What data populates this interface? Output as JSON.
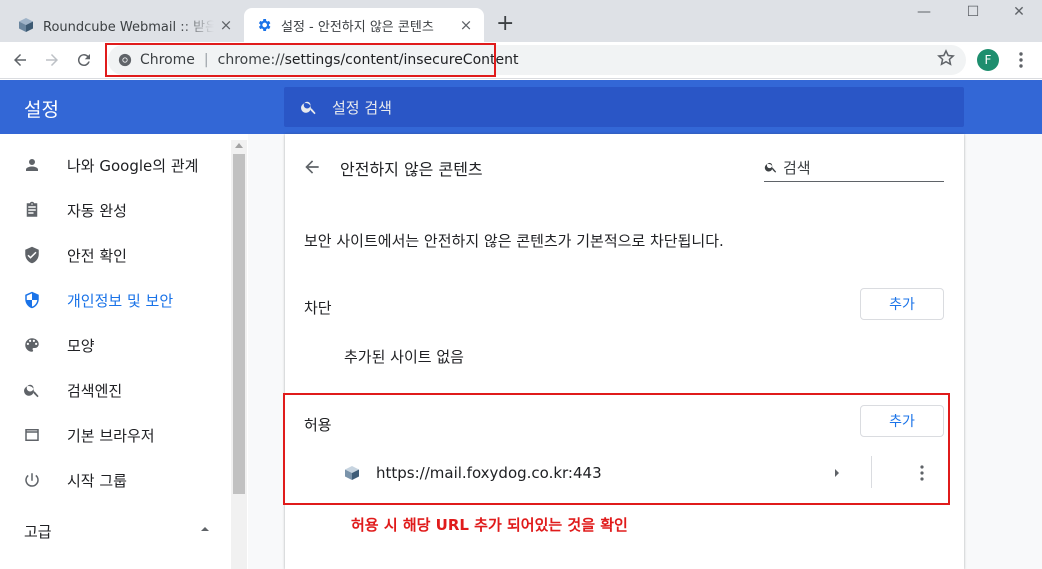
{
  "tabs": [
    {
      "title": "Roundcube Webmail :: 받은 편지함",
      "close": "×"
    },
    {
      "title": "설정 - 안전하지 않은 콘텐츠",
      "close": "×"
    }
  ],
  "newtab": "+",
  "window_controls": {
    "minimize": "—",
    "maximize": "☐",
    "close": "✕"
  },
  "toolbar": {
    "scheme_label": "Chrome",
    "separator": "|",
    "url_prefix": "chrome://",
    "url_path": "settings/content/insecureContent",
    "profile_initial": "F"
  },
  "settings": {
    "title": "설정",
    "search_placeholder": "설정 검색"
  },
  "sidebar": {
    "items": [
      {
        "label": "나와 Google의 관계",
        "icon": "person-icon"
      },
      {
        "label": "자동 완성",
        "icon": "clipboard-icon"
      },
      {
        "label": "안전 확인",
        "icon": "shield-check-icon"
      },
      {
        "label": "개인정보 및 보안",
        "icon": "shield-icon",
        "active": true
      },
      {
        "label": "모양",
        "icon": "palette-icon"
      },
      {
        "label": "검색엔진",
        "icon": "search-icon"
      },
      {
        "label": "기본 브라우저",
        "icon": "browser-icon"
      },
      {
        "label": "시작 그룹",
        "icon": "power-icon"
      }
    ],
    "advanced": "고급"
  },
  "page": {
    "title": "안전하지 않은 콘텐츠",
    "search_placeholder": "검색",
    "description": "보안 사이트에서는 안전하지 않은 콘텐츠가 기본적으로 차단됩니다.",
    "block": {
      "label": "차단",
      "add_label": "추가",
      "empty": "추가된 사이트 없음"
    },
    "allow": {
      "label": "허용",
      "add_label": "추가",
      "sites": [
        "https://mail.foxydog.co.kr:443"
      ]
    }
  },
  "annotation": "허용 시 해당 URL 추가 되어있는 것을 확인",
  "colors": {
    "accent": "#3367d6",
    "link": "#1a73e8",
    "highlight": "#e01b1b"
  }
}
